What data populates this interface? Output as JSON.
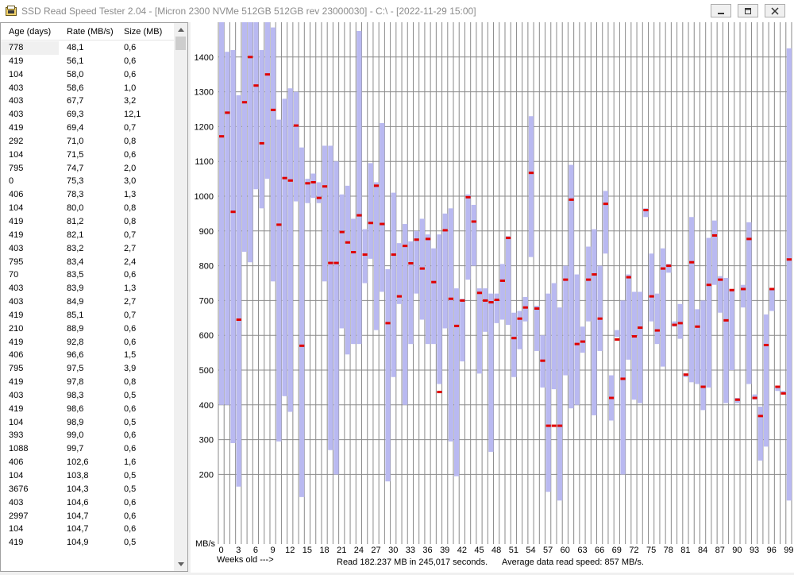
{
  "window": {
    "title": "SSD Read Speed Tester 2.04 - [Micron 2300 NVMe 512GB 512GB rev 23000030] - C:\\ - [2022-11-29 15:00]",
    "minimize_icon": "minimize-icon",
    "maximize_icon": "restore-icon",
    "close_icon": "close-icon"
  },
  "list": {
    "headers": [
      "Age (days)",
      "Rate (MB/s)",
      "Size (MB)"
    ],
    "rows": [
      [
        "778",
        "48,1",
        "0,6"
      ],
      [
        "419",
        "56,1",
        "0,6"
      ],
      [
        "104",
        "58,0",
        "0,6"
      ],
      [
        "403",
        "58,6",
        "1,0"
      ],
      [
        "403",
        "67,7",
        "3,2"
      ],
      [
        "403",
        "69,3",
        "12,1"
      ],
      [
        "419",
        "69,4",
        "0,7"
      ],
      [
        "292",
        "71,0",
        "0,8"
      ],
      [
        "104",
        "71,5",
        "0,6"
      ],
      [
        "795",
        "74,7",
        "2,0"
      ],
      [
        "0",
        "75,3",
        "3,0"
      ],
      [
        "406",
        "78,3",
        "1,3"
      ],
      [
        "104",
        "80,0",
        "0,8"
      ],
      [
        "419",
        "81,2",
        "0,8"
      ],
      [
        "419",
        "82,1",
        "0,7"
      ],
      [
        "403",
        "83,2",
        "2,7"
      ],
      [
        "795",
        "83,4",
        "2,4"
      ],
      [
        "70",
        "83,5",
        "0,6"
      ],
      [
        "403",
        "83,9",
        "1,3"
      ],
      [
        "403",
        "84,9",
        "2,7"
      ],
      [
        "419",
        "85,1",
        "0,7"
      ],
      [
        "210",
        "88,9",
        "0,6"
      ],
      [
        "419",
        "92,8",
        "0,6"
      ],
      [
        "406",
        "96,6",
        "1,5"
      ],
      [
        "795",
        "97,5",
        "3,9"
      ],
      [
        "419",
        "97,8",
        "0,8"
      ],
      [
        "403",
        "98,3",
        "0,5"
      ],
      [
        "419",
        "98,6",
        "0,6"
      ],
      [
        "104",
        "98,9",
        "0,5"
      ],
      [
        "393",
        "99,0",
        "0,6"
      ],
      [
        "1088",
        "99,7",
        "0,6"
      ],
      [
        "406",
        "102,6",
        "1,6"
      ],
      [
        "104",
        "103,8",
        "0,5"
      ],
      [
        "3676",
        "104,3",
        "0,5"
      ],
      [
        "403",
        "104,6",
        "0,6"
      ],
      [
        "2997",
        "104,7",
        "0,6"
      ],
      [
        "104",
        "104,7",
        "0,6"
      ],
      [
        "419",
        "104,9",
        "0,5"
      ]
    ]
  },
  "chart_data": {
    "type": "bar",
    "description_bars": "range bars (min-max) with average marker per week",
    "ylabel": "MB/s",
    "xlabel": "Weeks old --->",
    "ylim": [
      0,
      1500
    ],
    "yticks": [
      200,
      300,
      400,
      500,
      600,
      700,
      800,
      900,
      1000,
      1100,
      1200,
      1300,
      1400
    ],
    "xlim": [
      0,
      99
    ],
    "xticks": [
      0,
      3,
      6,
      9,
      12,
      15,
      18,
      21,
      24,
      27,
      30,
      33,
      36,
      39,
      42,
      45,
      48,
      51,
      54,
      57,
      60,
      63,
      66,
      69,
      72,
      75,
      78,
      81,
      84,
      87,
      90,
      93,
      96,
      99
    ],
    "grid": true,
    "bar_color": "#b9b9f1",
    "avg_color": "#e00000",
    "weeks": [
      {
        "w": 0,
        "min": 400,
        "max": 1500,
        "avg": 1172
      },
      {
        "w": 1,
        "min": 400,
        "max": 1415,
        "avg": 1240
      },
      {
        "w": 2,
        "min": 290,
        "max": 1420,
        "avg": 955
      },
      {
        "w": 3,
        "min": 165,
        "max": 1290,
        "avg": 645
      },
      {
        "w": 4,
        "min": 840,
        "max": 1500,
        "avg": 1270
      },
      {
        "w": 5,
        "min": 810,
        "max": 1500,
        "avg": 1400
      },
      {
        "w": 6,
        "min": 1020,
        "max": 1500,
        "avg": 1318
      },
      {
        "w": 7,
        "min": 965,
        "max": 1420,
        "avg": 1152
      },
      {
        "w": 8,
        "min": 1050,
        "max": 1500,
        "avg": 1350
      },
      {
        "w": 9,
        "min": 755,
        "max": 1485,
        "avg": 1248
      },
      {
        "w": 10,
        "min": 295,
        "max": 1220,
        "avg": 918
      },
      {
        "w": 11,
        "min": 425,
        "max": 1280,
        "avg": 1052
      },
      {
        "w": 12,
        "min": 380,
        "max": 1310,
        "avg": 1045
      },
      {
        "w": 13,
        "min": 985,
        "max": 1300,
        "avg": 1203
      },
      {
        "w": 14,
        "min": 135,
        "max": 1140,
        "avg": 570
      },
      {
        "w": 15,
        "min": 980,
        "max": 1050,
        "avg": 1037
      },
      {
        "w": 16,
        "min": 995,
        "max": 1065,
        "avg": 1040
      },
      {
        "w": 17,
        "min": 980,
        "max": 1040,
        "avg": 995
      },
      {
        "w": 18,
        "min": 755,
        "max": 1145,
        "avg": 1028
      },
      {
        "w": 19,
        "min": 270,
        "max": 1145,
        "avg": 808
      },
      {
        "w": 20,
        "min": 200,
        "max": 1100,
        "avg": 808
      },
      {
        "w": 21,
        "min": 620,
        "max": 1005,
        "avg": 897
      },
      {
        "w": 22,
        "min": 545,
        "max": 1030,
        "avg": 867
      },
      {
        "w": 23,
        "min": 575,
        "max": 935,
        "avg": 839
      },
      {
        "w": 24,
        "min": 575,
        "max": 1475,
        "avg": 945
      },
      {
        "w": 25,
        "min": 750,
        "max": 905,
        "avg": 832
      },
      {
        "w": 26,
        "min": 820,
        "max": 1095,
        "avg": 923
      },
      {
        "w": 27,
        "min": 615,
        "max": 1040,
        "avg": 1030
      },
      {
        "w": 28,
        "min": 725,
        "max": 1210,
        "avg": 920
      },
      {
        "w": 29,
        "min": 180,
        "max": 790,
        "avg": 635
      },
      {
        "w": 30,
        "min": 480,
        "max": 1010,
        "avg": 832
      },
      {
        "w": 31,
        "min": 690,
        "max": 865,
        "avg": 712
      },
      {
        "w": 32,
        "min": 400,
        "max": 920,
        "avg": 857
      },
      {
        "w": 33,
        "min": 575,
        "max": 870,
        "avg": 807
      },
      {
        "w": 34,
        "min": 720,
        "max": 900,
        "avg": 875
      },
      {
        "w": 35,
        "min": 645,
        "max": 935,
        "avg": 792
      },
      {
        "w": 36,
        "min": 575,
        "max": 890,
        "avg": 877
      },
      {
        "w": 37,
        "min": 575,
        "max": 850,
        "avg": 753
      },
      {
        "w": 38,
        "min": 460,
        "max": 890,
        "avg": 437
      },
      {
        "w": 39,
        "min": 620,
        "max": 950,
        "avg": 902
      },
      {
        "w": 40,
        "min": 295,
        "max": 965,
        "avg": 705
      },
      {
        "w": 41,
        "min": 195,
        "max": 735,
        "avg": 627
      },
      {
        "w": 42,
        "min": 525,
        "max": 705,
        "avg": 700
      },
      {
        "w": 43,
        "min": 760,
        "max": 1005,
        "avg": 997
      },
      {
        "w": 44,
        "min": 800,
        "max": 975,
        "avg": 927
      },
      {
        "w": 45,
        "min": 490,
        "max": 735,
        "avg": 722
      },
      {
        "w": 46,
        "min": 610,
        "max": 735,
        "avg": 700
      },
      {
        "w": 47,
        "min": 265,
        "max": 720,
        "avg": 695
      },
      {
        "w": 48,
        "min": 635,
        "max": 720,
        "avg": 702
      },
      {
        "w": 49,
        "min": 645,
        "max": 805,
        "avg": 757
      },
      {
        "w": 50,
        "min": 630,
        "max": 885,
        "avg": 880
      },
      {
        "w": 51,
        "min": 480,
        "max": 665,
        "avg": 592
      },
      {
        "w": 52,
        "min": 560,
        "max": 670,
        "avg": 648
      },
      {
        "w": 53,
        "min": 640,
        "max": 710,
        "avg": 680
      },
      {
        "w": 54,
        "min": 825,
        "max": 1230,
        "avg": 1067
      },
      {
        "w": 55,
        "min": 555,
        "max": 685,
        "avg": 677
      },
      {
        "w": 56,
        "min": 450,
        "max": 600,
        "avg": 527
      },
      {
        "w": 57,
        "min": 150,
        "max": 720,
        "avg": 340
      },
      {
        "w": 58,
        "min": 445,
        "max": 750,
        "avg": 340
      },
      {
        "w": 59,
        "min": 125,
        "max": 680,
        "avg": 340
      },
      {
        "w": 60,
        "min": 485,
        "max": 800,
        "avg": 760
      },
      {
        "w": 61,
        "min": 390,
        "max": 1090,
        "avg": 990
      },
      {
        "w": 62,
        "min": 400,
        "max": 775,
        "avg": 575
      },
      {
        "w": 63,
        "min": 550,
        "max": 625,
        "avg": 582
      },
      {
        "w": 64,
        "min": 640,
        "max": 855,
        "avg": 760
      },
      {
        "w": 65,
        "min": 370,
        "max": 905,
        "avg": 775
      },
      {
        "w": 66,
        "min": 555,
        "max": 800,
        "avg": 648
      },
      {
        "w": 67,
        "min": 835,
        "max": 1015,
        "avg": 978
      },
      {
        "w": 68,
        "min": 355,
        "max": 485,
        "avg": 420
      },
      {
        "w": 69,
        "min": 595,
        "max": 615,
        "avg": 588
      },
      {
        "w": 70,
        "min": 200,
        "max": 700,
        "avg": 475
      },
      {
        "w": 71,
        "min": 530,
        "max": 775,
        "avg": 767
      },
      {
        "w": 72,
        "min": 415,
        "max": 725,
        "avg": 597
      },
      {
        "w": 73,
        "min": 405,
        "max": 725,
        "avg": 622
      },
      {
        "w": 74,
        "min": 940,
        "max": 965,
        "avg": 960
      },
      {
        "w": 75,
        "min": 640,
        "max": 835,
        "avg": 712
      },
      {
        "w": 76,
        "min": 575,
        "max": 720,
        "avg": 614
      },
      {
        "w": 77,
        "min": 510,
        "max": 850,
        "avg": 792
      },
      {
        "w": 78,
        "min": 780,
        "max": 805,
        "avg": 800
      },
      {
        "w": 79,
        "min": 625,
        "max": 640,
        "avg": 630
      },
      {
        "w": 80,
        "min": 590,
        "max": 690,
        "avg": 635
      },
      {
        "w": 81,
        "min": 480,
        "max": 490,
        "avg": 487
      },
      {
        "w": 82,
        "min": 465,
        "max": 940,
        "avg": 810
      },
      {
        "w": 83,
        "min": 460,
        "max": 675,
        "avg": 625
      },
      {
        "w": 84,
        "min": 385,
        "max": 700,
        "avg": 452
      },
      {
        "w": 85,
        "min": 450,
        "max": 880,
        "avg": 745
      },
      {
        "w": 86,
        "min": 745,
        "max": 930,
        "avg": 887
      },
      {
        "w": 87,
        "min": 665,
        "max": 770,
        "avg": 760
      },
      {
        "w": 88,
        "min": 405,
        "max": 765,
        "avg": 643
      },
      {
        "w": 89,
        "min": 500,
        "max": 730,
        "avg": 730
      },
      {
        "w": 90,
        "min": 405,
        "max": 420,
        "avg": 415
      },
      {
        "w": 91,
        "min": 680,
        "max": 745,
        "avg": 733
      },
      {
        "w": 92,
        "min": 460,
        "max": 925,
        "avg": 877
      },
      {
        "w": 93,
        "min": 415,
        "max": 430,
        "avg": 420
      },
      {
        "w": 94,
        "min": 240,
        "max": 395,
        "avg": 368
      },
      {
        "w": 95,
        "min": 280,
        "max": 660,
        "avg": 572
      },
      {
        "w": 96,
        "min": 670,
        "max": 735,
        "avg": 733
      },
      {
        "w": 97,
        "min": 440,
        "max": 455,
        "avg": 452
      },
      {
        "w": 98,
        "min": 430,
        "max": 440,
        "avg": 433
      },
      {
        "w": 99,
        "min": 125,
        "max": 1425,
        "avg": 818
      }
    ]
  },
  "status": {
    "read_summary": "Read 182.237 MB in 245,017 seconds.",
    "avg_summary": "Average data read speed: 857 MB/s."
  }
}
